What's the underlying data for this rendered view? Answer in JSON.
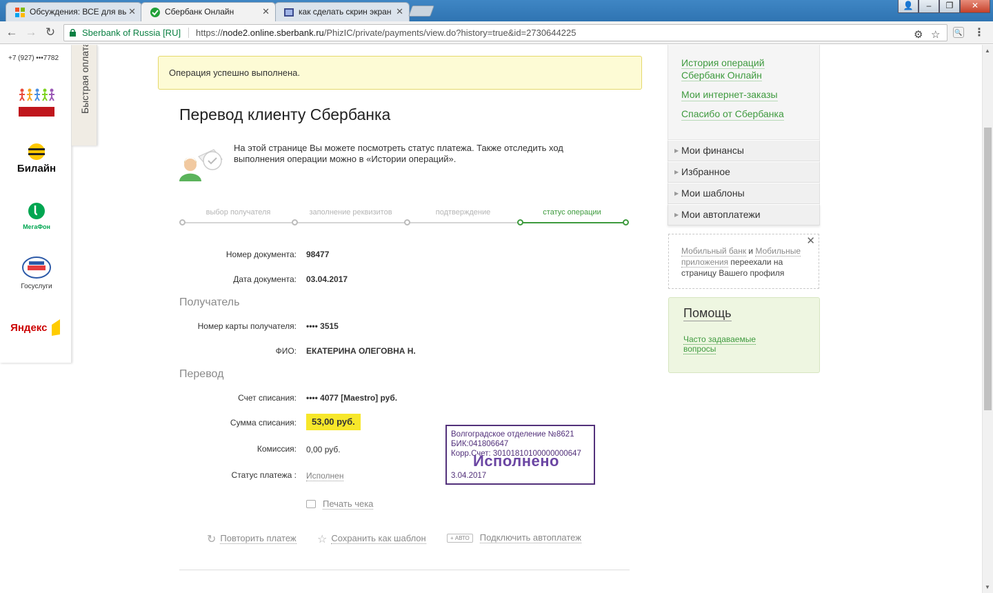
{
  "browser": {
    "tabs": [
      {
        "title": "Обсуждения: ВСЕ для вы"
      },
      {
        "title": "Сбербанк Онлайн"
      },
      {
        "title": "как сделать скрин экран"
      }
    ],
    "secure_label": "Sberbank of Russia [RU]",
    "url_scheme": "https://",
    "url_host": "node2.online.sberbank.ru",
    "url_path": "/PhizIC/private/payments/view.do?history=true&id=2730644225"
  },
  "left_panel": {
    "phone": "+7 (927) •••7782",
    "quick_pay_label": "Быстрая оплата",
    "providers": [
      {
        "name": "Подари жизнь"
      },
      {
        "name": "Билайн"
      },
      {
        "name": "МегаФон"
      },
      {
        "name": "Госуслуги"
      },
      {
        "name": "Яндекс"
      }
    ],
    "beeline_logo": "Билайн",
    "megafon_logo": "МегаФон",
    "gos_label": "Госуслуги",
    "yandex_logo": "Яндекс"
  },
  "notice": "Операция успешно выполнена.",
  "page_title": "Перевод клиенту Сбербанка",
  "info_text": "На этой странице Вы можете посмотреть статус платежа. Также отследить ход выполнения операции можно в «Истории операций».",
  "steps": [
    {
      "label": "выбор получателя",
      "active": false
    },
    {
      "label": "заполнение реквизитов",
      "active": false
    },
    {
      "label": "подтверждение",
      "active": false
    },
    {
      "label": "статус операции",
      "active": true
    }
  ],
  "document": {
    "number_label": "Номер документа:",
    "number": "98477",
    "date_label": "Дата документа:",
    "date": "03.04.2017"
  },
  "recipient": {
    "section": "Получатель",
    "card_label": "Номер карты получателя:",
    "card": "•••• 3515",
    "name_label": "ФИО:",
    "name": "ЕКАТЕРИНА ОЛЕГОВНА Н."
  },
  "transfer": {
    "section": "Перевод",
    "account_label": "Счет списания:",
    "account": "•••• 4077  [Maestro]  руб.",
    "amount_label": "Сумма списания:",
    "amount": "53,00  руб.",
    "fee_label": "Комиссия:",
    "fee": "0,00 руб.",
    "status_label": "Статус платежа :",
    "status": "Исполнен"
  },
  "stamp": {
    "line1": "Волгоградское отделение №8621",
    "line2": "БИК:041806647",
    "line3": "Корр.Счет: 30101810100000000647",
    "status": "Исполнено",
    "date": "3.04.2017"
  },
  "print_label": "Печать чека",
  "actions": {
    "repeat": "Повторить платеж",
    "save_template": "Сохранить как шаблон",
    "auto_badge": "+ АВТО",
    "autopay": "Подключить автоплатеж"
  },
  "right": {
    "links": [
      {
        "label": "История операций Сбербанк Онлайн"
      },
      {
        "label": "Мои интернет-заказы"
      },
      {
        "label": "Спасибо от Сбербанка"
      }
    ],
    "menu": [
      {
        "label": "Мои финансы"
      },
      {
        "label": "Избранное"
      },
      {
        "label": "Мои шаблоны"
      },
      {
        "label": "Мои автоплатежи"
      }
    ],
    "mobile_notice": {
      "link1": "Мобильный банк",
      "and": " и ",
      "link2": "Мобильные приложения",
      "rest": " переехали на страницу Вашего профиля"
    },
    "help_title": "Помощь",
    "help_link": "Часто задаваемые вопросы"
  },
  "colors": {
    "brand_green": "#3d9a3d",
    "highlight_yellow": "#f7e72a",
    "stamp_purple": "#52307a",
    "notice_bg": "#fdfbd5"
  }
}
